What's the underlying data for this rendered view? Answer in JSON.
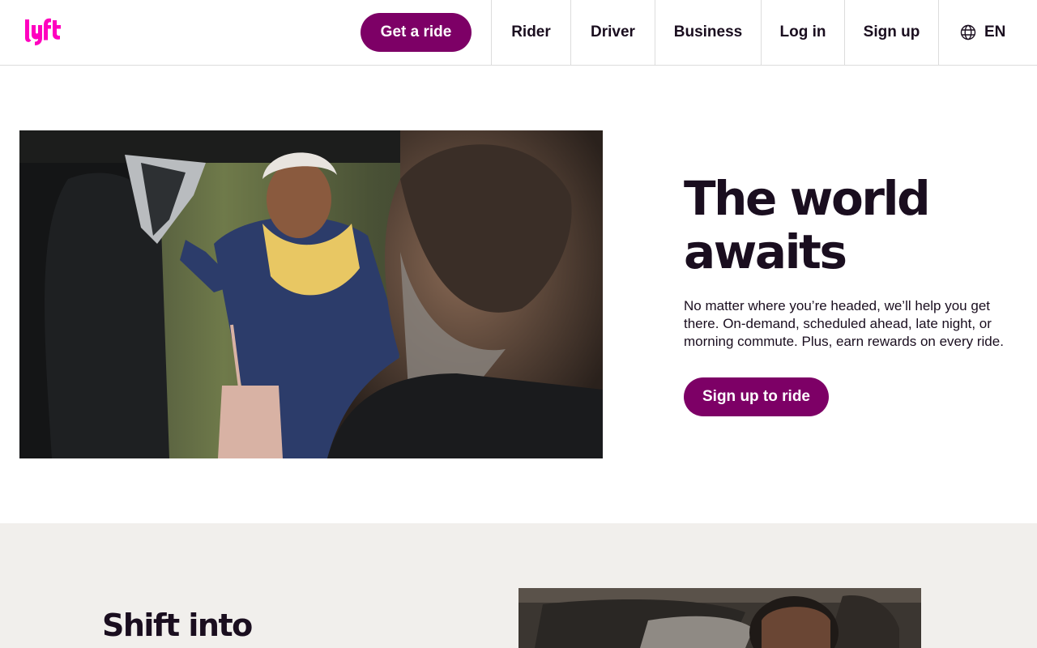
{
  "header": {
    "logo_text": "lyft",
    "get_ride_label": "Get a ride",
    "nav": {
      "rider": "Rider",
      "driver": "Driver",
      "business": "Business",
      "login": "Log in",
      "signup": "Sign up",
      "language": "EN"
    }
  },
  "hero": {
    "title": "The world awaits",
    "body": "No matter where you’re headed, we’ll help you get there. On-demand, scheduled ahead, late night, or morning commute. Plus, earn rewards on every ride.",
    "cta_label": "Sign up to ride"
  },
  "section2": {
    "title": "Shift into"
  },
  "colors": {
    "brand_pink": "#ff00bf",
    "button_purple": "#7d0066",
    "text_dark": "#1a0e1f",
    "section_bg": "#f1efec"
  },
  "icons": {
    "language": "globe-icon"
  }
}
